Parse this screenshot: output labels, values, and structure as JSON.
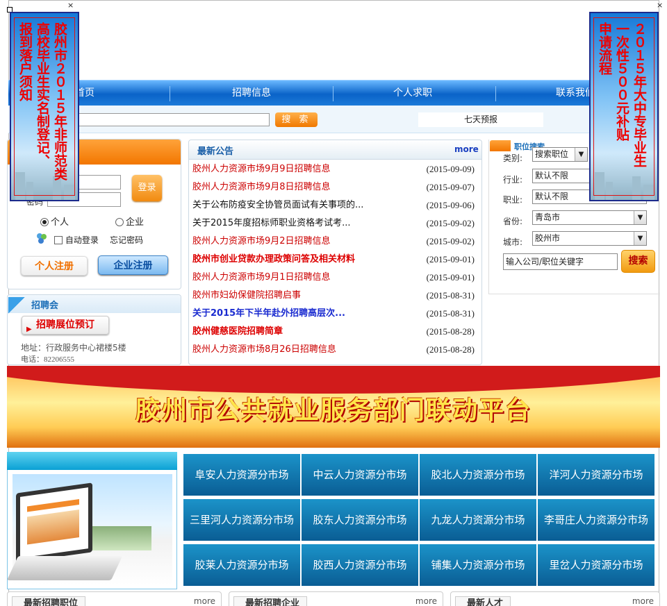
{
  "nav": {
    "items": [
      "首页",
      "招聘信息",
      "个人求职",
      "联系我们"
    ]
  },
  "search": {
    "button": "搜  索",
    "forecast": "七天预报"
  },
  "login": {
    "button": "登录",
    "password_label": "密码",
    "radio_person": "个人",
    "radio_company": "企业",
    "auto_login": "自动登录",
    "forgot": "忘记密码",
    "person_register": "个人注册",
    "company_register": "企业注册"
  },
  "fair": {
    "title": "招聘会",
    "booking": "招聘展位预订",
    "address": "地址：行政服务中心裙楼5楼",
    "phone": "电话：82206555"
  },
  "notices": {
    "title": "最新公告",
    "more": "more",
    "items": [
      {
        "title": "胶州人力资源市场9月9日招聘信息",
        "date": "(2015-09-09)",
        "style": "red"
      },
      {
        "title": "胶州人力资源市场9月8日招聘信息",
        "date": "(2015-09-07)",
        "style": "red"
      },
      {
        "title": "关于公布防疫安全协管员面试有关事项的...",
        "date": "(2015-09-06)",
        "style": "black"
      },
      {
        "title": "关于2015年度招标师职业资格考试考...",
        "date": "(2015-09-02)",
        "style": "black"
      },
      {
        "title": "胶州人力资源市场9月2日招聘信息",
        "date": "(2015-09-02)",
        "style": "red"
      },
      {
        "title": "胶州市创业贷款办理政策问答及相关材料",
        "date": "(2015-09-01)",
        "style": "bred"
      },
      {
        "title": "胶州人力资源市场9月1日招聘信息",
        "date": "(2015-09-01)",
        "style": "red"
      },
      {
        "title": "胶州市妇幼保健院招聘启事",
        "date": "(2015-08-31)",
        "style": "red"
      },
      {
        "title": "关于2015年下半年赴外招聘高层次...",
        "date": "(2015-08-31)",
        "style": "bblue"
      },
      {
        "title": "胶州健慈医院招聘简章",
        "date": "(2015-08-28)",
        "style": "bred"
      },
      {
        "title": "胶州人力资源市场8月26日招聘信息",
        "date": "(2015-08-28)",
        "style": "red"
      }
    ]
  },
  "job_search": {
    "title": "职位搜索",
    "labels": {
      "type": "类别:",
      "industry": "行业:",
      "position": "职业:",
      "province": "省份:",
      "city": "城市:"
    },
    "values": {
      "type": "搜索职位",
      "industry": "默认不限",
      "position": "默认不限",
      "province": "青岛市",
      "city": "胶州市"
    },
    "keyword": "输入公司/职位关键字",
    "button": "搜索"
  },
  "banner": {
    "title": "胶州市公共就业服务部门联动平台"
  },
  "markets": [
    "阜安人力资源分市场",
    "中云人力资源分市场",
    "胶北人力资源分市场",
    "洋河人力资源分市场",
    "三里河人力资源分市场",
    "胶东人力资源分市场",
    "九龙人力资源分市场",
    "李哥庄人力资源分市场",
    "胶莱人力资源分市场",
    "胶西人力资源分市场",
    "铺集人力资源分市场",
    "里岔人力资源分市场"
  ],
  "bottom": [
    {
      "title": "最新招聘职位",
      "more": "more"
    },
    {
      "title": "最新招聘企业",
      "more": "more"
    },
    {
      "title": "最新人才",
      "more": "more"
    }
  ],
  "float_left": {
    "close": "×",
    "columns": [
      "胶州市２０１５年非师范类",
      "高校毕业生实名制登记、",
      "报到落户须知"
    ]
  },
  "float_right": {
    "close": "×",
    "columns": [
      "２０１５年大中专毕业生",
      "一次性５００元补贴",
      "申请流程"
    ]
  },
  "colors": {
    "nav": "#0a63c8",
    "orange": "#f27600",
    "market": "#0a5d94",
    "red": "#cc0000"
  }
}
